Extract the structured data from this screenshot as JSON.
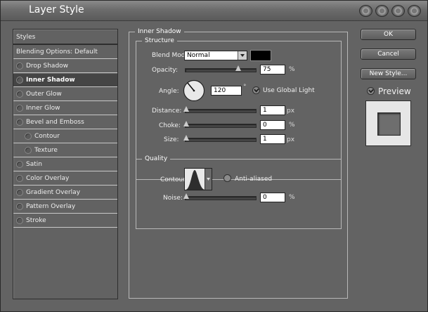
{
  "window": {
    "title": "Layer Style"
  },
  "styles_panel": {
    "header": "Styles",
    "items": [
      {
        "label": "Blending Options: Default",
        "has_radio": false,
        "indent": false,
        "selected": false
      },
      {
        "label": "Drop Shadow",
        "has_radio": true,
        "indent": false,
        "selected": false
      },
      {
        "label": "Inner Shadow",
        "has_radio": true,
        "indent": false,
        "selected": true
      },
      {
        "label": "Outer Glow",
        "has_radio": true,
        "indent": false,
        "selected": false
      },
      {
        "label": "Inner Glow",
        "has_radio": true,
        "indent": false,
        "selected": false
      },
      {
        "label": "Bevel and Emboss",
        "has_radio": true,
        "indent": false,
        "selected": false
      },
      {
        "label": "Contour",
        "has_radio": true,
        "indent": true,
        "selected": false
      },
      {
        "label": "Texture",
        "has_radio": true,
        "indent": true,
        "selected": false
      },
      {
        "label": "Satin",
        "has_radio": true,
        "indent": false,
        "selected": false
      },
      {
        "label": "Color Overlay",
        "has_radio": true,
        "indent": false,
        "selected": false
      },
      {
        "label": "Gradient Overlay",
        "has_radio": true,
        "indent": false,
        "selected": false
      },
      {
        "label": "Pattern Overlay",
        "has_radio": true,
        "indent": false,
        "selected": false
      },
      {
        "label": "Stroke",
        "has_radio": true,
        "indent": false,
        "selected": false
      }
    ]
  },
  "inner_shadow": {
    "title": "Inner Shadow",
    "structure": {
      "title": "Structure",
      "blend_mode_label": "Blend Mode:",
      "blend_mode_value": "Normal",
      "shadow_color": "#000000",
      "opacity_label": "Opacity:",
      "opacity_value": "75",
      "opacity_unit": "%",
      "angle_label": "Angle:",
      "angle_value": "120",
      "angle_unit": "°",
      "global_light_label": "Use Global Light",
      "distance_label": "Distance:",
      "distance_value": "1",
      "distance_unit": "px",
      "choke_label": "Choke:",
      "choke_value": "0",
      "choke_unit": "%",
      "size_label": "Size:",
      "size_value": "1",
      "size_unit": "px"
    },
    "quality": {
      "title": "Quality",
      "contour_label": "Contour:",
      "anti_aliased_label": "Anti-aliased",
      "noise_label": "Noise:",
      "noise_value": "0",
      "noise_unit": "%"
    }
  },
  "buttons": {
    "ok": "OK",
    "cancel": "Cancel",
    "new_style": "New Style..."
  },
  "preview": {
    "label": "Preview"
  }
}
